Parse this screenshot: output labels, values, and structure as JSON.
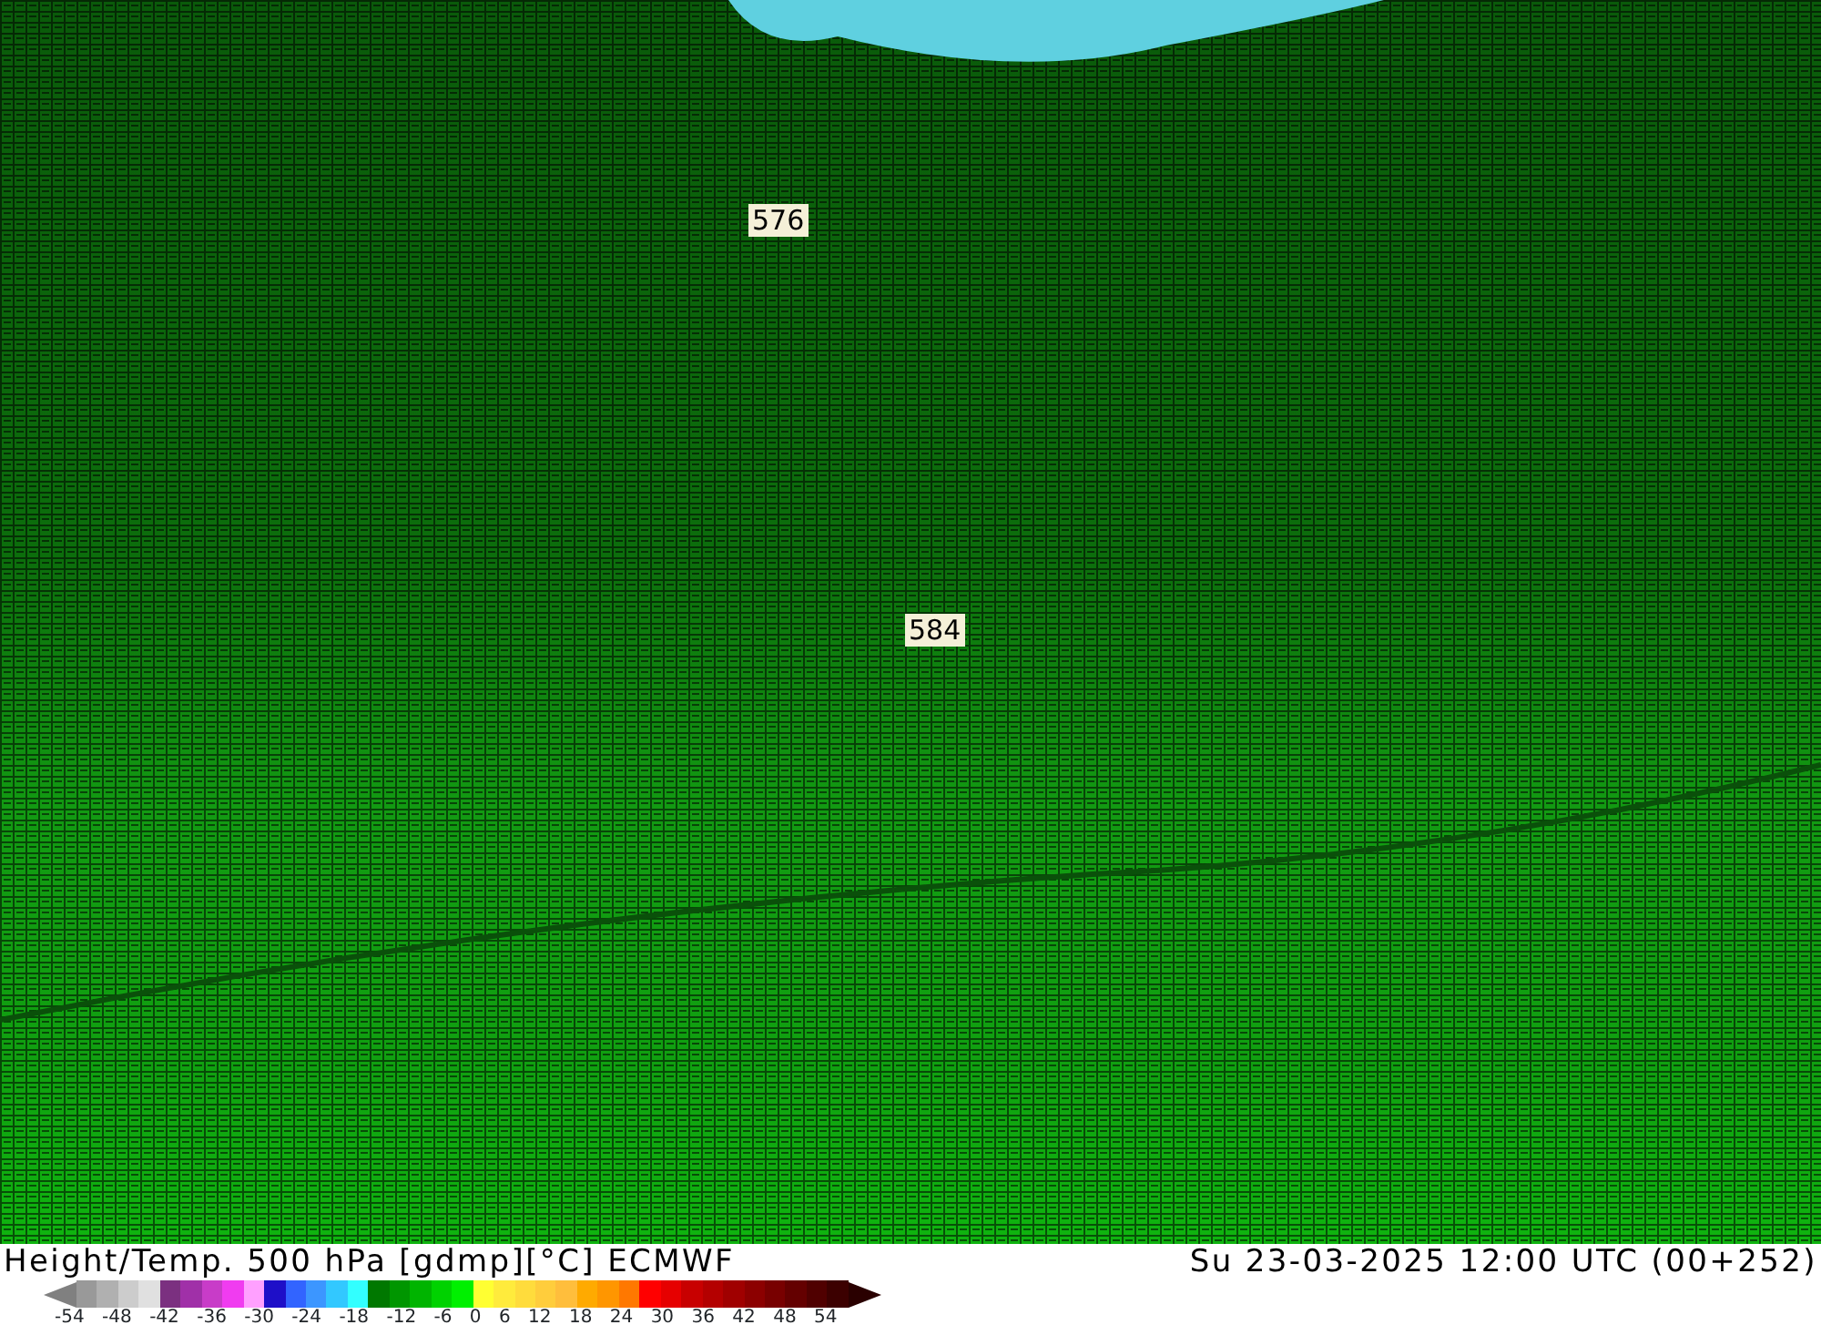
{
  "map": {
    "contour_labels": [
      "576",
      "584"
    ]
  },
  "footer": {
    "title": "Height/Temp. 500 hPa [gdmp][°C] ECMWF",
    "valid_time": "Su 23-03-2025 12:00 UTC (00+252)"
  },
  "legend": {
    "low_end": {
      "color": "#808080"
    },
    "high_end": {
      "color": "#2a0000"
    },
    "swatches": [
      {
        "color": "#999999"
      },
      {
        "color": "#b0b0b0"
      },
      {
        "color": "#cccccc"
      },
      {
        "color": "#e0e0e0"
      },
      {
        "color": "#7b3080"
      },
      {
        "color": "#a030a8"
      },
      {
        "color": "#c83cc8"
      },
      {
        "color": "#f03cf0"
      },
      {
        "color": "#ffa0ff"
      },
      {
        "color": "#1e0fc8"
      },
      {
        "color": "#3264ff"
      },
      {
        "color": "#3c96ff"
      },
      {
        "color": "#32c8ff"
      },
      {
        "color": "#32ffff"
      },
      {
        "color": "#007800"
      },
      {
        "color": "#009600"
      },
      {
        "color": "#00b400"
      },
      {
        "color": "#00d200"
      },
      {
        "color": "#00f000"
      },
      {
        "color": "#ffff32"
      },
      {
        "color": "#ffeb3c"
      },
      {
        "color": "#ffdc3c"
      },
      {
        "color": "#ffcd3c"
      },
      {
        "color": "#ffbe3c"
      },
      {
        "color": "#ffaa00"
      },
      {
        "color": "#ff9600"
      },
      {
        "color": "#ff7800"
      },
      {
        "color": "#ff0000"
      },
      {
        "color": "#e60000"
      },
      {
        "color": "#c80000"
      },
      {
        "color": "#b40000"
      },
      {
        "color": "#a00000"
      },
      {
        "color": "#8c0000"
      },
      {
        "color": "#780000"
      },
      {
        "color": "#640000"
      },
      {
        "color": "#500000"
      },
      {
        "color": "#3c0000"
      }
    ],
    "ticks": [
      "-54",
      "-48",
      "-42",
      "-36",
      "-30",
      "-24",
      "-18",
      "-12",
      "-6",
      "0",
      "6",
      "12",
      "18",
      "24",
      "30",
      "36",
      "42",
      "48",
      "54"
    ]
  }
}
